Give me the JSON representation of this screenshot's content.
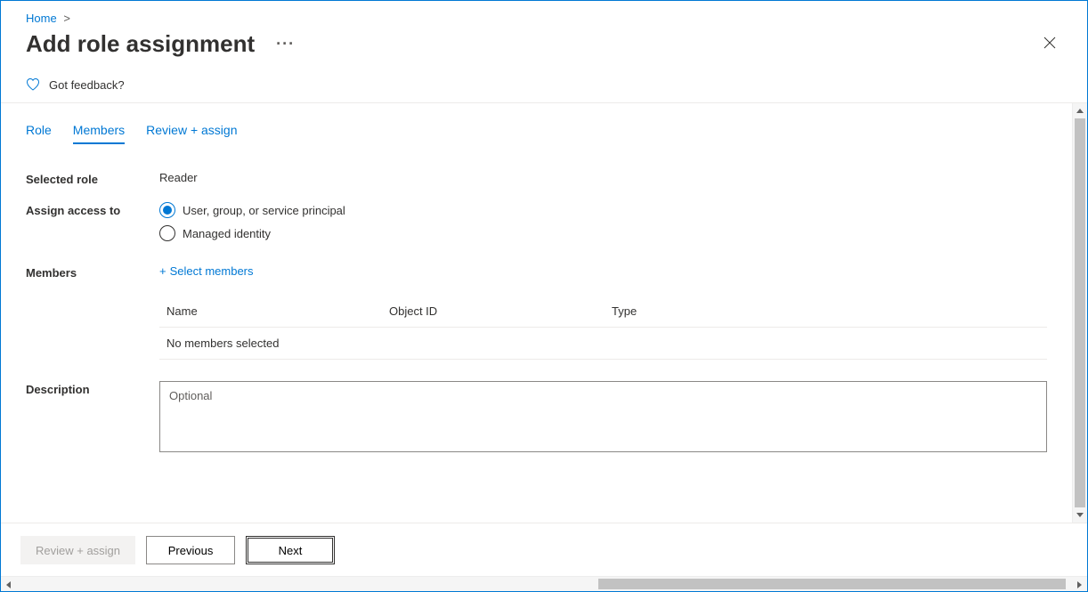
{
  "breadcrumb": {
    "home": "Home"
  },
  "page": {
    "title": "Add role assignment",
    "more_glyph": "···"
  },
  "feedback": {
    "label": "Got feedback?"
  },
  "tabs": {
    "role": "Role",
    "members": "Members",
    "review": "Review + assign"
  },
  "form": {
    "selected_role_label": "Selected role",
    "selected_role_value": "Reader",
    "assign_label": "Assign access to",
    "assign_opt1": "User, group, or service principal",
    "assign_opt2": "Managed identity",
    "members_label": "Members",
    "select_members_label": "Select members",
    "description_label": "Description",
    "description_placeholder": "Optional"
  },
  "table": {
    "col_name": "Name",
    "col_objid": "Object ID",
    "col_type": "Type",
    "empty_msg": "No members selected"
  },
  "footer": {
    "review": "Review + assign",
    "previous": "Previous",
    "next": "Next"
  }
}
